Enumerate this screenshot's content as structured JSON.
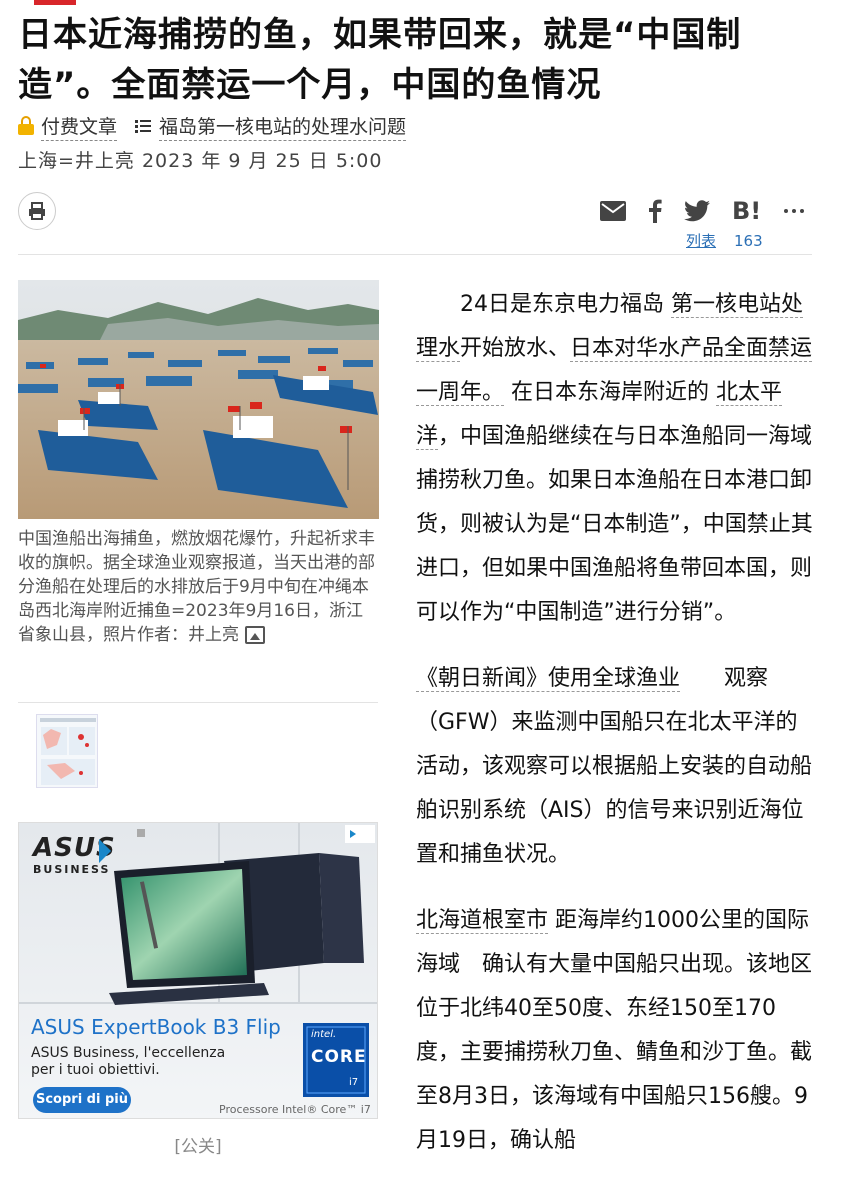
{
  "headline": "日本近海捕捞的鱼，如果带回来，就是“中国制造”。全面禁运一个月，中国的鱼情况",
  "meta": {
    "paid_label": "付费文章",
    "topic_label": "福岛第一核电站的处理水问题"
  },
  "byline": "上海=井上亮  2023 年 9 月 25 日 5:00",
  "share": {
    "list_label": "列表",
    "count": "163",
    "hatena_label": "B!"
  },
  "photo": {
    "caption": "中国渔船出海捕鱼，燃放烟花爆竹，升起祈求丰收的旗帜。据全球渔业观察报道，当天出港的部分渔船在处理后的水排放后于9月中旬在冲绳本岛西北海岸附近捕鱼=2023年9月16日，浙江省象山县，照片作者：井上亮"
  },
  "ad": {
    "brand_line1": "ASUS",
    "brand_line2": "BUSINESS",
    "product": "ASUS ExpertBook B3 Flip",
    "tagline": "ASUS Business, l'eccellenza per i tuoi obiettivi.",
    "cta": "Scopri di più",
    "chip_line1": "intel.",
    "chip_line2": "CORE",
    "chip_line3": "i7",
    "footer": "Processore Intel® Core™ i7",
    "label": "[公关]"
  },
  "article": {
    "p1_a": "24日是东京电力福岛 ",
    "p1_link1": "第一核电站处理水",
    "p1_b": "开始放水、",
    "p1_link2": "日本对华水产品全面禁运一周年。",
    "p1_c": " 在日本东海岸附近的 ",
    "p1_link3": "北太平洋",
    "p1_d": "，中国渔船继续在与日本渔船同一海域捕捞秋刀鱼。如果日本渔船在日本港口卸货，则被认为是“日本制造”，中国禁止其进口，但如果中国渔船将鱼带回本国，则可以作为“中国制造”进行分销”。",
    "p2_link": "《朝日新闻》使用全球渔业",
    "p2_a": "观察（GFW）来监测中国船只在北太平洋的活动，该观察可以根据船上安装的自动船舶识别系统（AIS）的信号来识别近海位置和捕鱼状况。",
    "p3_link": "北海道根室市",
    "p3_a": " 距海岸约1000公里的国际海域　确认有大量中国船只出现。该地区位于北纬40至50度、东经150至170度，主要捕捞秋刀鱼、鲭鱼和沙丁鱼。截至8月3日，该海域有中国船只156艘。9月19日，确认船"
  }
}
